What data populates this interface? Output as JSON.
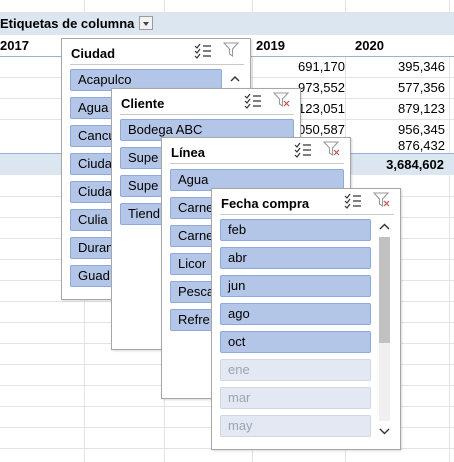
{
  "pivot": {
    "column_labels_header": "Etiquetas de columna",
    "years": [
      "2017",
      "2019",
      "2020"
    ],
    "col_2019": [
      "691,170",
      "973,552",
      "123,051",
      "050,587",
      ""
    ],
    "col_2020": [
      "395,346",
      "577,356",
      "879,123",
      "956,345",
      "876,432"
    ],
    "total_2019": "3,684,602"
  },
  "slicers": {
    "ciudad": {
      "title": "Ciudad",
      "items": [
        "Acapulco",
        "Agua",
        "Cancu",
        "Ciuda",
        "Ciuda",
        "Culia",
        "Duran",
        "Guad"
      ]
    },
    "cliente": {
      "title": "Cliente",
      "items": [
        "Bodega ABC",
        "Supe",
        "Supe",
        "Tiend"
      ]
    },
    "linea": {
      "title": "Línea",
      "items": [
        "Agua",
        "Carne",
        "Carne",
        "Licor",
        "Pesca",
        "Refre"
      ]
    },
    "fecha": {
      "title": "Fecha compra",
      "items_selected": [
        "feb",
        "abr",
        "jun",
        "ago",
        "oct"
      ],
      "items_dim": [
        "ene",
        "mar",
        "may"
      ]
    }
  },
  "icons": [
    "multi-select-icon",
    "clear-filter-icon",
    "dropdown-arrow-icon",
    "scroll-up-icon",
    "scroll-down-icon"
  ],
  "colors": {
    "selected_item": "#b4c6e7",
    "dim_item": "#e3e8f2",
    "header_band": "#dce6f1"
  }
}
